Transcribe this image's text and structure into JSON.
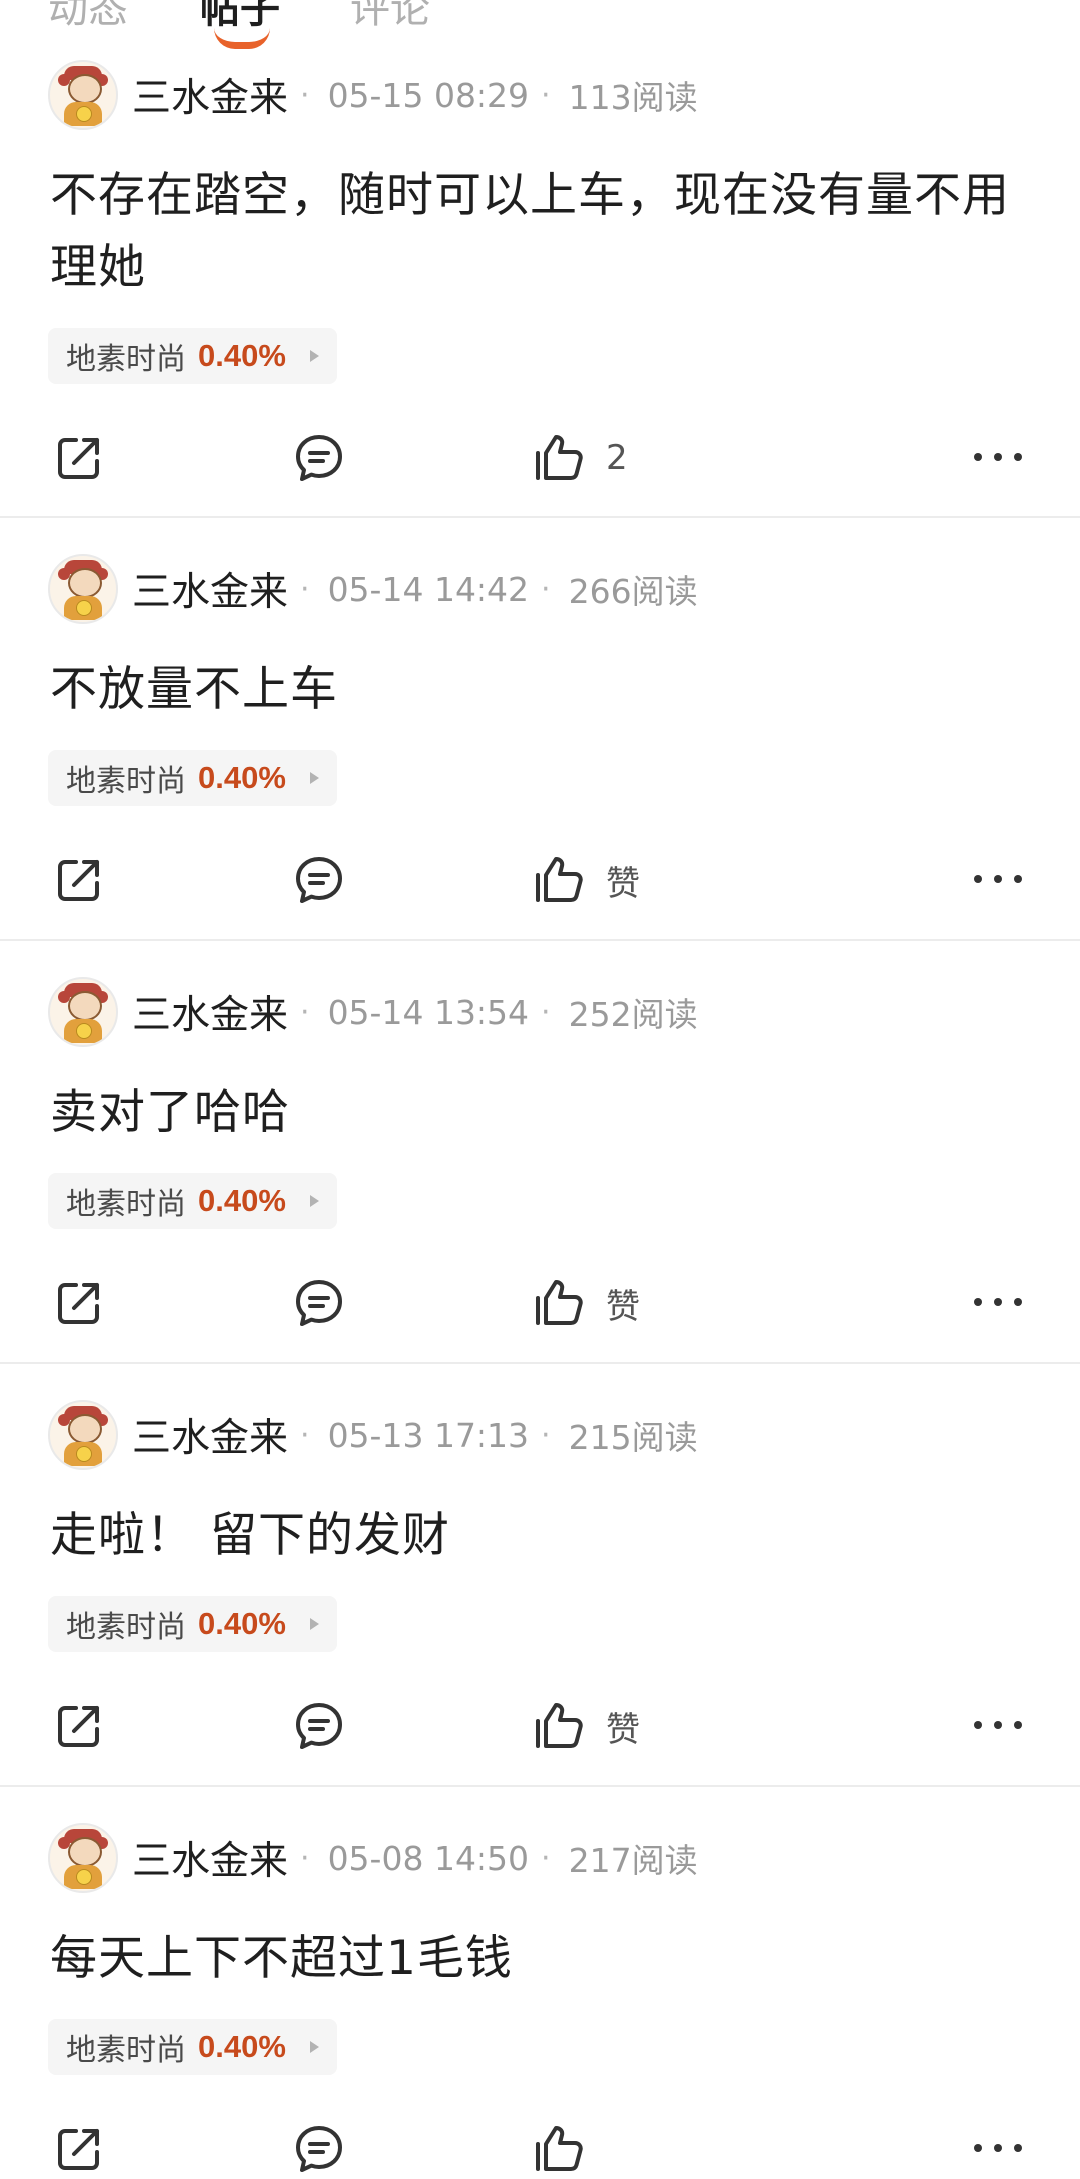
{
  "tabs": [
    {
      "label": "动态",
      "active": false
    },
    {
      "label": "帖子",
      "active": true
    },
    {
      "label": "评论",
      "active": false
    }
  ],
  "actions": {
    "share": "分享",
    "comment": "评论"
  },
  "colors": {
    "accent": "#e8622a",
    "stock_change": "#c74a1c",
    "divider": "#ececec"
  },
  "icons": {
    "share": "share-icon",
    "comment": "comment-icon",
    "like": "thumbs-up-icon",
    "more": "more-icon"
  },
  "posts": [
    {
      "username": "三水金来",
      "datetime": "05-15 08:29",
      "reads": "113阅读",
      "text": "不存在踏空，随时可以上车，现在没有量不用理她",
      "stock": {
        "name": "地素时尚",
        "change": "0.40%"
      },
      "like_label": "2"
    },
    {
      "username": "三水金来",
      "datetime": "05-14 14:42",
      "reads": "266阅读",
      "text": "不放量不上车",
      "stock": {
        "name": "地素时尚",
        "change": "0.40%"
      },
      "like_label": "赞"
    },
    {
      "username": "三水金来",
      "datetime": "05-14 13:54",
      "reads": "252阅读",
      "text": "卖对了哈哈",
      "stock": {
        "name": "地素时尚",
        "change": "0.40%"
      },
      "like_label": "赞"
    },
    {
      "username": "三水金来",
      "datetime": "05-13 17:13",
      "reads": "215阅读",
      "text": "走啦！ 留下的发财",
      "stock": {
        "name": "地素时尚",
        "change": "0.40%"
      },
      "like_label": "赞"
    },
    {
      "username": "三水金来",
      "datetime": "05-08 14:50",
      "reads": "217阅读",
      "text": "每天上下不超过1毛钱",
      "stock": {
        "name": "地素时尚",
        "change": "0.40%"
      },
      "like_label": ""
    }
  ]
}
